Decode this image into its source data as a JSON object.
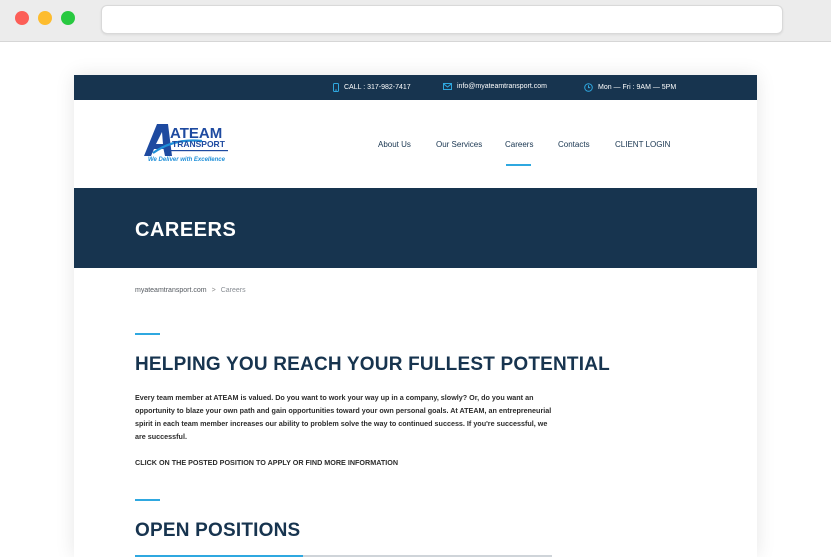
{
  "topbar": {
    "phone": "CALL : 317-982-7417",
    "email": "info@myateamtransport.com",
    "hours": "Mon — Fri : 9AM — 5PM"
  },
  "logo": {
    "main": "ATEAM",
    "sub": "TRANSPORT",
    "tagline": "We Deliver with Excellence"
  },
  "nav": {
    "about": "About Us",
    "services": "Our Services",
    "careers": "Careers",
    "contacts": "Contacts",
    "login": "CLIENT LOGIN"
  },
  "hero": {
    "title": "CAREERS"
  },
  "breadcrumb": {
    "home": "myateamtransport.com",
    "separator": ">",
    "current": "Careers"
  },
  "section1": {
    "heading": "HELPING YOU REACH YOUR FULLEST POTENTIAL",
    "paragraph": "Every team member at ATEAM is valued. Do you want to work your way up in a company, slowly? Or, do you want an opportunity to blaze your own path and gain opportunities toward your own personal goals. At ATEAM, an entrepreneurial spirit in each team member increases our ability to problem solve the way to continued success. If you're successful, we are successful.",
    "cta": "CLICK ON THE POSTED POSITION TO APPLY OR FIND MORE INFORMATION"
  },
  "section2": {
    "heading": "OPEN POSITIONS"
  },
  "colors": {
    "navy": "#17344f",
    "accent": "#2fa8e0",
    "logo_blue": "#1e4aa0"
  }
}
